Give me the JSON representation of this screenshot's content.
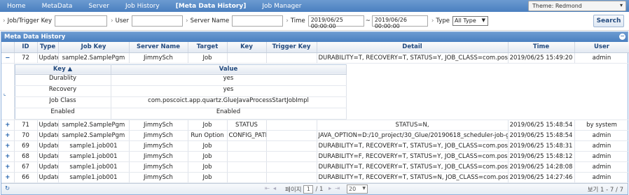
{
  "nav": {
    "items": [
      "Home",
      "MetaData",
      "Server",
      "Job History",
      "[Meta Data History]",
      "Job Manager"
    ],
    "theme_label": "Theme: Redmond"
  },
  "search": {
    "job_trigger_key_label": "Job/Trigger Key",
    "user_label": "User",
    "server_name_label": "Server Name",
    "time_label": "Time",
    "time_from": "2019/06/25 00:00:00",
    "time_to": "2019/06/26 00:00:00",
    "type_label": "Type",
    "type_value": "All Type",
    "button_label": "Search"
  },
  "grid": {
    "caption": "Meta Data History",
    "columns": [
      "ID",
      "Type",
      "Job Key",
      "Server Name",
      "Target",
      "Key",
      "Trigger Key",
      "Detail",
      "Time",
      "User"
    ],
    "expanded_row": {
      "pm": "−",
      "id": "72",
      "type": "Update",
      "job_key": "sample2.SamplePgm",
      "server": "JimmySch",
      "target": "Job",
      "key": "",
      "trigger_key": "",
      "detail": "DURABILITY=T, RECOVERY=T, STATUS=Y, JOB_CLASS=com.poscoict.a",
      "time": "2019/06/25 15:49:20",
      "user": "admin"
    },
    "subgrid": {
      "columns": [
        "Key ▲",
        "Value"
      ],
      "rows": [
        {
          "key": "Durablity",
          "value": "yes"
        },
        {
          "key": "Recovery",
          "value": "yes"
        },
        {
          "key": "Job Class",
          "value": "com.poscoict.app.quartz.GlueJavaProcessStartJobImpl"
        },
        {
          "key": "Enabled",
          "value": "Enabled"
        }
      ]
    },
    "rows": [
      {
        "pm": "+",
        "id": "71",
        "type": "Update",
        "job_key": "sample2.SamplePgm",
        "server": "JimmySch",
        "target": "Job",
        "key": "STATUS",
        "trigger_key": "",
        "detail": "STATUS=N,",
        "time": "2019/06/25 15:48:54",
        "user": "by system"
      },
      {
        "pm": "+",
        "id": "70",
        "type": "Update",
        "job_key": "sample2.SamplePgm",
        "server": "JimmySch",
        "target": "Run Option",
        "key": "CONFIG_PATH",
        "trigger_key": "",
        "detail": "JAVA_OPTION=D:/10_project/30_Glue/20190618_scheduler-job-gro",
        "time": "2019/06/25 15:48:54",
        "user": "admin"
      },
      {
        "pm": "+",
        "id": "69",
        "type": "Update",
        "job_key": "sample1.job001",
        "server": "JimmySch",
        "target": "Job",
        "key": "",
        "trigger_key": "",
        "detail": "DURABILITY=T, RECOVERY=T, STATUS=Y, JOB_CLASS=com.poscoict.a",
        "time": "2019/06/25 15:48:31",
        "user": "admin"
      },
      {
        "pm": "+",
        "id": "68",
        "type": "Update",
        "job_key": "sample1.job001",
        "server": "JimmySch",
        "target": "Job",
        "key": "",
        "trigger_key": "",
        "detail": "DURABILITY=F, RECOVERY=T, STATUS=Y, JOB_CLASS=com.poscoict.a",
        "time": "2019/06/25 15:48:12",
        "user": "admin"
      },
      {
        "pm": "+",
        "id": "67",
        "type": "Update",
        "job_key": "sample1.job001",
        "server": "JimmySch",
        "target": "Job",
        "key": "",
        "trigger_key": "",
        "detail": "DURABILITY=T, RECOVERY=T, STATUS=Y, JOB_CLASS=com.poscoict.a",
        "time": "2019/06/25 14:28:08",
        "user": "admin"
      },
      {
        "pm": "+",
        "id": "66",
        "type": "Update",
        "job_key": "sample1.job001",
        "server": "JimmySch",
        "target": "Job",
        "key": "",
        "trigger_key": "",
        "detail": "DURABILITY=T, RECOVERY=T, STATUS=N, JOB_CLASS=com.poscoict.a",
        "time": "2019/06/25 14:27:46",
        "user": "admin"
      }
    ]
  },
  "pager": {
    "page_label": "페이지",
    "page_value": "1",
    "page_total": "/ 1",
    "rows_per_page": "20",
    "info": "보기 1 - 7 / 7",
    "nav_first_prev": "⇤ ◂",
    "nav_next_last": "▸ ⇥",
    "refresh_icon": "↻"
  }
}
